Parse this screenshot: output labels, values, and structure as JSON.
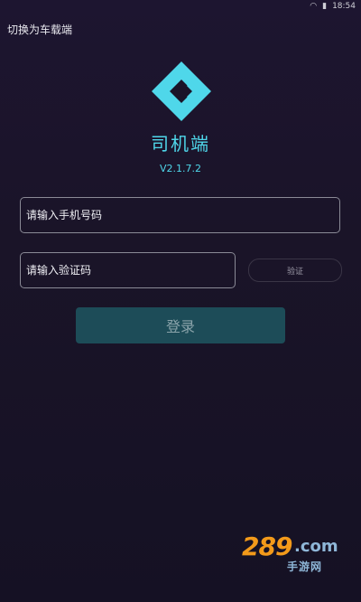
{
  "status_bar": {
    "time": "18:54"
  },
  "header": {
    "switch_label": "切换为车载端"
  },
  "app": {
    "title": "司机端",
    "version": "V2.1.7.2"
  },
  "form": {
    "phone_placeholder": "请输入手机号码",
    "code_placeholder": "请输入验证码",
    "verify_label": "验证",
    "login_label": "登录"
  },
  "watermark": {
    "number": "289",
    "com": ".com",
    "sub": "手游网"
  },
  "colors": {
    "accent": "#4fd7ea",
    "login_bg": "#1d4c58",
    "background": "#1a1428"
  }
}
